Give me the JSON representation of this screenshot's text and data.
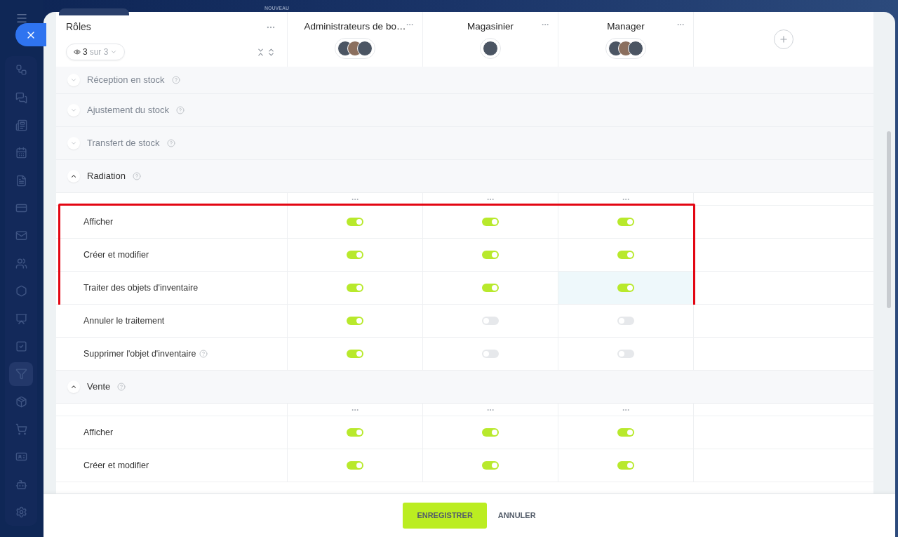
{
  "top_bar": {
    "badge": "NOUVEAU"
  },
  "sidebar_items": [
    {
      "selected": false
    },
    {
      "selected": false
    },
    {
      "selected": false
    },
    {
      "selected": false
    },
    {
      "selected": false
    },
    {
      "selected": false
    },
    {
      "selected": false
    },
    {
      "selected": false
    },
    {
      "selected": false
    },
    {
      "selected": false
    },
    {
      "selected": false
    },
    {
      "selected": true
    },
    {
      "selected": false
    },
    {
      "selected": false
    },
    {
      "selected": false
    },
    {
      "selected": false
    },
    {
      "selected": false
    }
  ],
  "roles_column": {
    "title": "Rôles",
    "visible_count": "3",
    "total": "sur 3"
  },
  "roles": [
    {
      "name": "Administrateurs de bo…",
      "avatars": [
        {
          "kind": "photo"
        },
        {
          "kind": "photo"
        },
        {
          "kind": "photo"
        }
      ]
    },
    {
      "name": "Magasinier",
      "avatars": [
        {
          "kind": "photo"
        }
      ]
    },
    {
      "name": "Manager",
      "avatars": [
        {
          "kind": "photo"
        },
        {
          "kind": "photo"
        },
        {
          "kind": "photo"
        }
      ]
    }
  ],
  "sections": [
    {
      "title": "Réception en stock",
      "expanded": false
    },
    {
      "title": "Ajustement du stock",
      "expanded": false
    },
    {
      "title": "Transfert de stock",
      "expanded": false
    },
    {
      "title": "Radiation",
      "expanded": true,
      "rows": [
        {
          "label": "Afficher",
          "help": false,
          "framed": true,
          "toggles": [
            {
              "on": true,
              "highlighted": false
            },
            {
              "on": true,
              "highlighted": false
            },
            {
              "on": true,
              "highlighted": false
            }
          ]
        },
        {
          "label": "Créer et modifier",
          "help": false,
          "framed": true,
          "toggles": [
            {
              "on": true,
              "highlighted": false
            },
            {
              "on": true,
              "highlighted": false
            },
            {
              "on": true,
              "highlighted": false
            }
          ]
        },
        {
          "label": "Traiter des objets d'inventaire",
          "help": false,
          "framed": true,
          "toggles": [
            {
              "on": true,
              "highlighted": false
            },
            {
              "on": true,
              "highlighted": false
            },
            {
              "on": true,
              "highlighted": true
            }
          ]
        },
        {
          "label": "Annuler le traitement",
          "help": false,
          "framed": false,
          "toggles": [
            {
              "on": true,
              "highlighted": false
            },
            {
              "on": false,
              "highlighted": false
            },
            {
              "on": false,
              "highlighted": false
            }
          ]
        },
        {
          "label": "Supprimer l'objet d'inventaire",
          "help": true,
          "framed": false,
          "toggles": [
            {
              "on": true,
              "highlighted": false
            },
            {
              "on": false,
              "highlighted": false
            },
            {
              "on": false,
              "highlighted": false
            }
          ]
        }
      ]
    },
    {
      "title": "Vente",
      "expanded": true,
      "rows": [
        {
          "label": "Afficher",
          "help": false,
          "framed": false,
          "toggles": [
            {
              "on": true,
              "highlighted": false
            },
            {
              "on": true,
              "highlighted": false
            },
            {
              "on": true,
              "highlighted": false
            }
          ]
        },
        {
          "label": "Créer et modifier",
          "help": false,
          "framed": false,
          "toggles": [
            {
              "on": true,
              "highlighted": false
            },
            {
              "on": true,
              "highlighted": false
            },
            {
              "on": true,
              "highlighted": false
            }
          ]
        }
      ]
    }
  ],
  "footer": {
    "save": "ENREGISTRER",
    "cancel": "ANNULER"
  }
}
